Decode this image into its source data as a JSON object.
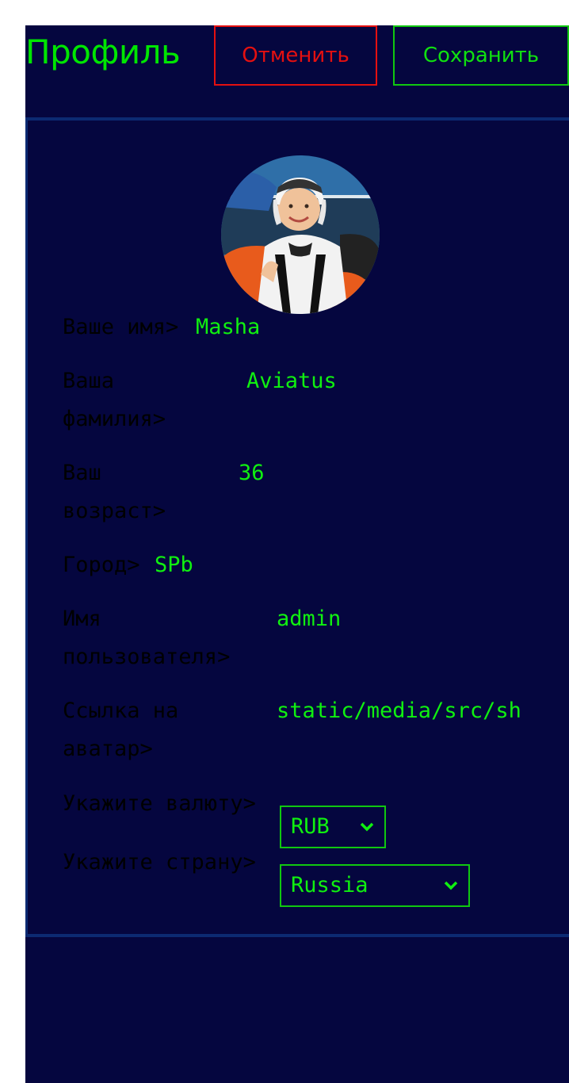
{
  "header": {
    "title": "Профиль",
    "cancel_label": "Отменить",
    "save_label": "Сохранить"
  },
  "colors": {
    "background": "#05063f",
    "accent_green": "#10f010",
    "cancel_red": "#e51010",
    "label_text": "#000000",
    "divider": "#0c2a72"
  },
  "profile": {
    "avatar_icon": "user-photo-skydiver",
    "fields": [
      {
        "label": "Ваше имя>",
        "value": "Masha"
      },
      {
        "label": "Ваша\nфамилия>",
        "value": "Aviatus"
      },
      {
        "label": "Ваш\nвозраст>",
        "value": "36"
      },
      {
        "label": "Город>",
        "value": "SPb"
      },
      {
        "label": "Имя\nпользователя>",
        "value": "admin"
      },
      {
        "label": "Ссылка на\nаватар>",
        "value": "static/media/src/sh"
      }
    ],
    "currency": {
      "label": "Укажите валюту>",
      "selected": "RUB",
      "icon": "chevron-down-icon"
    },
    "country": {
      "label": "Укажите страну>",
      "selected": "Russia",
      "icon": "chevron-down-icon"
    }
  }
}
